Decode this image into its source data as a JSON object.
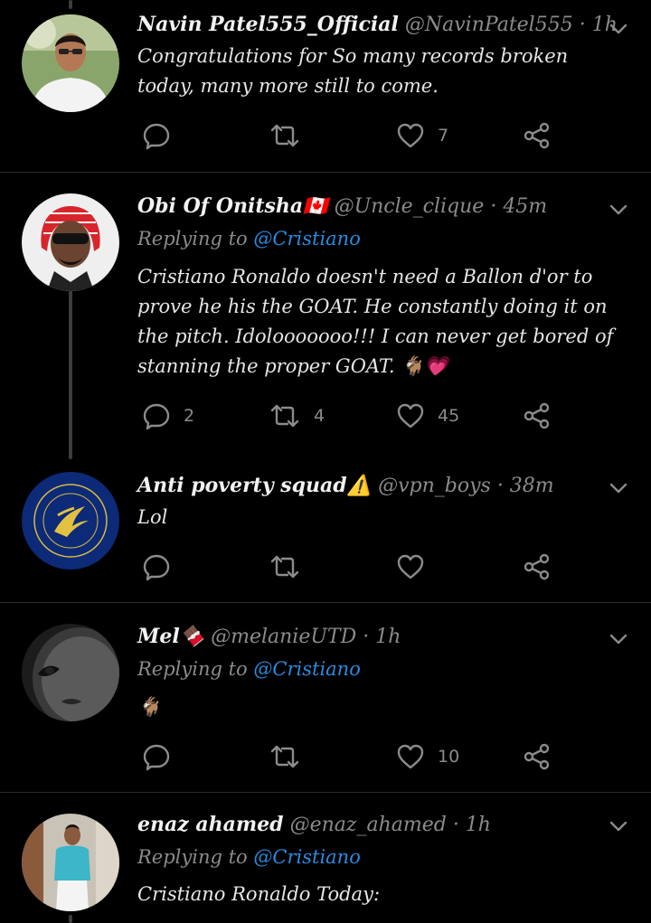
{
  "colors": {
    "background": "#000000",
    "text": "#e6e6e6",
    "muted": "#8b8b8b",
    "link": "#2a8be0",
    "divider": "#2a2a2a"
  },
  "tweets": [
    {
      "name": "Navin Patel555_Official",
      "handle": "@NavinPatel555",
      "time": "· 1h",
      "text": "Congratulations for So many records broken today, many more still to come.",
      "replies": "",
      "retweets": "",
      "likes": "7"
    },
    {
      "name": "Obi Of Onitsha🇨🇦",
      "handle": "@Uncle_clique",
      "time": "· 45m",
      "reply_prefix": "Replying to",
      "reply_to": "@Cristiano",
      "text": "Cristiano Ronaldo doesn't need a Ballon d'or to prove he his the GOAT. He constantly doing it on the pitch. Idolooooooo!!! I can never get bored of stanning the proper GOAT. 🐐💗",
      "replies": "2",
      "retweets": "4",
      "likes": "45"
    },
    {
      "name": "Anti poverty squad⚠️",
      "handle": "@vpn_boys",
      "time": "· 38m",
      "text": "Lol",
      "replies": "",
      "retweets": "",
      "likes": ""
    },
    {
      "name": "Mel🍫",
      "handle": "@melanieUTD",
      "time": "· 1h",
      "reply_prefix": "Replying to",
      "reply_to": "@Cristiano",
      "text": "🐐",
      "replies": "",
      "retweets": "",
      "likes": "10"
    },
    {
      "name": "enaz ahamed",
      "handle": "@enaz_ahamed",
      "time": "· 1h",
      "reply_prefix": "Replying to",
      "reply_to": "@Cristiano",
      "text": "Cristiano Ronaldo Today:"
    }
  ]
}
